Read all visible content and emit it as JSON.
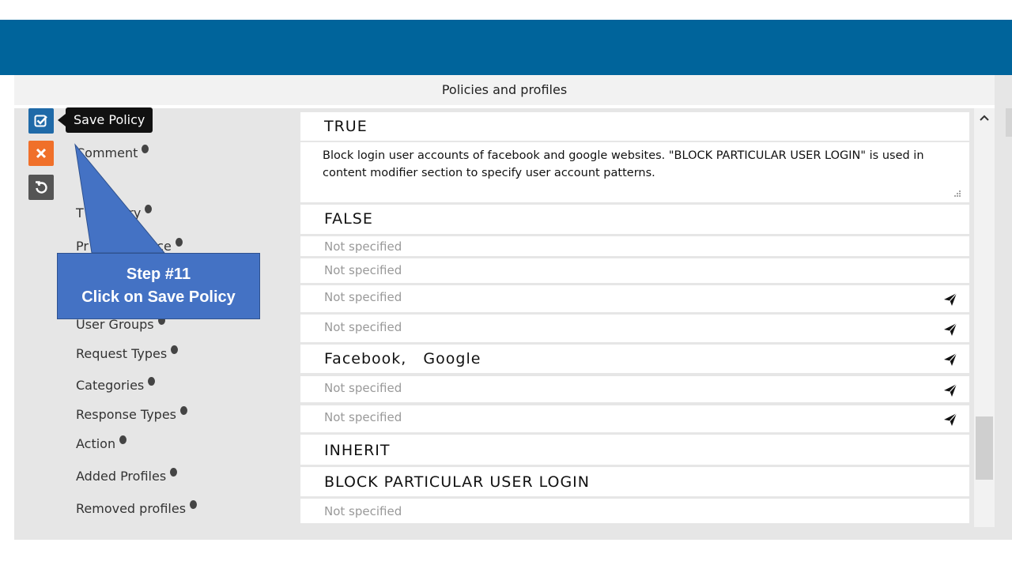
{
  "header": {
    "title": "Policies and profiles"
  },
  "toolbar": {
    "save_tooltip": "Save Policy"
  },
  "fields": {
    "enabled_value": "TRUE",
    "comment_label": "Comment",
    "comment_value": "Block login user accounts of facebook and google websites. \"BLOCK PARTICULAR USER LOGIN\" is used in content modifier section to specify user account patterns.",
    "temp_label": "T",
    "temp_label_tail": "Entry",
    "temp_value": "FALSE",
    "priority_label": "Pr",
    "priority_label_tail": "tance",
    "priority_value": "Not specified",
    "row5_value": "Not specified",
    "row6_value": "Not specified",
    "user_groups_label": "User Groups",
    "user_groups_value": "Not specified",
    "request_types_label": "Request Types",
    "request_types_value": "Facebook,   Google",
    "categories_label": "Categories",
    "categories_value": "Not specified",
    "response_types_label": "Response Types",
    "response_types_value": "Not specified",
    "action_label": "Action",
    "action_value": "INHERIT",
    "added_profiles_label": "Added Profiles",
    "added_profiles_value": "BLOCK PARTICULAR USER LOGIN",
    "removed_profiles_label": "Removed profiles",
    "removed_profiles_value": "Not specified"
  },
  "callout": {
    "line1": "Step #11",
    "line2": "Click on Save Policy"
  },
  "colors": {
    "header_bar": "#00649b",
    "save_button": "#1f6aa8",
    "cancel_button": "#f0702a",
    "reset_button": "#555555",
    "callout": "#4472c4"
  },
  "icons": {
    "save": "check-square-icon",
    "cancel": "close-icon",
    "reset": "undo-icon",
    "picker": "send-icon",
    "info": "info-icon"
  }
}
